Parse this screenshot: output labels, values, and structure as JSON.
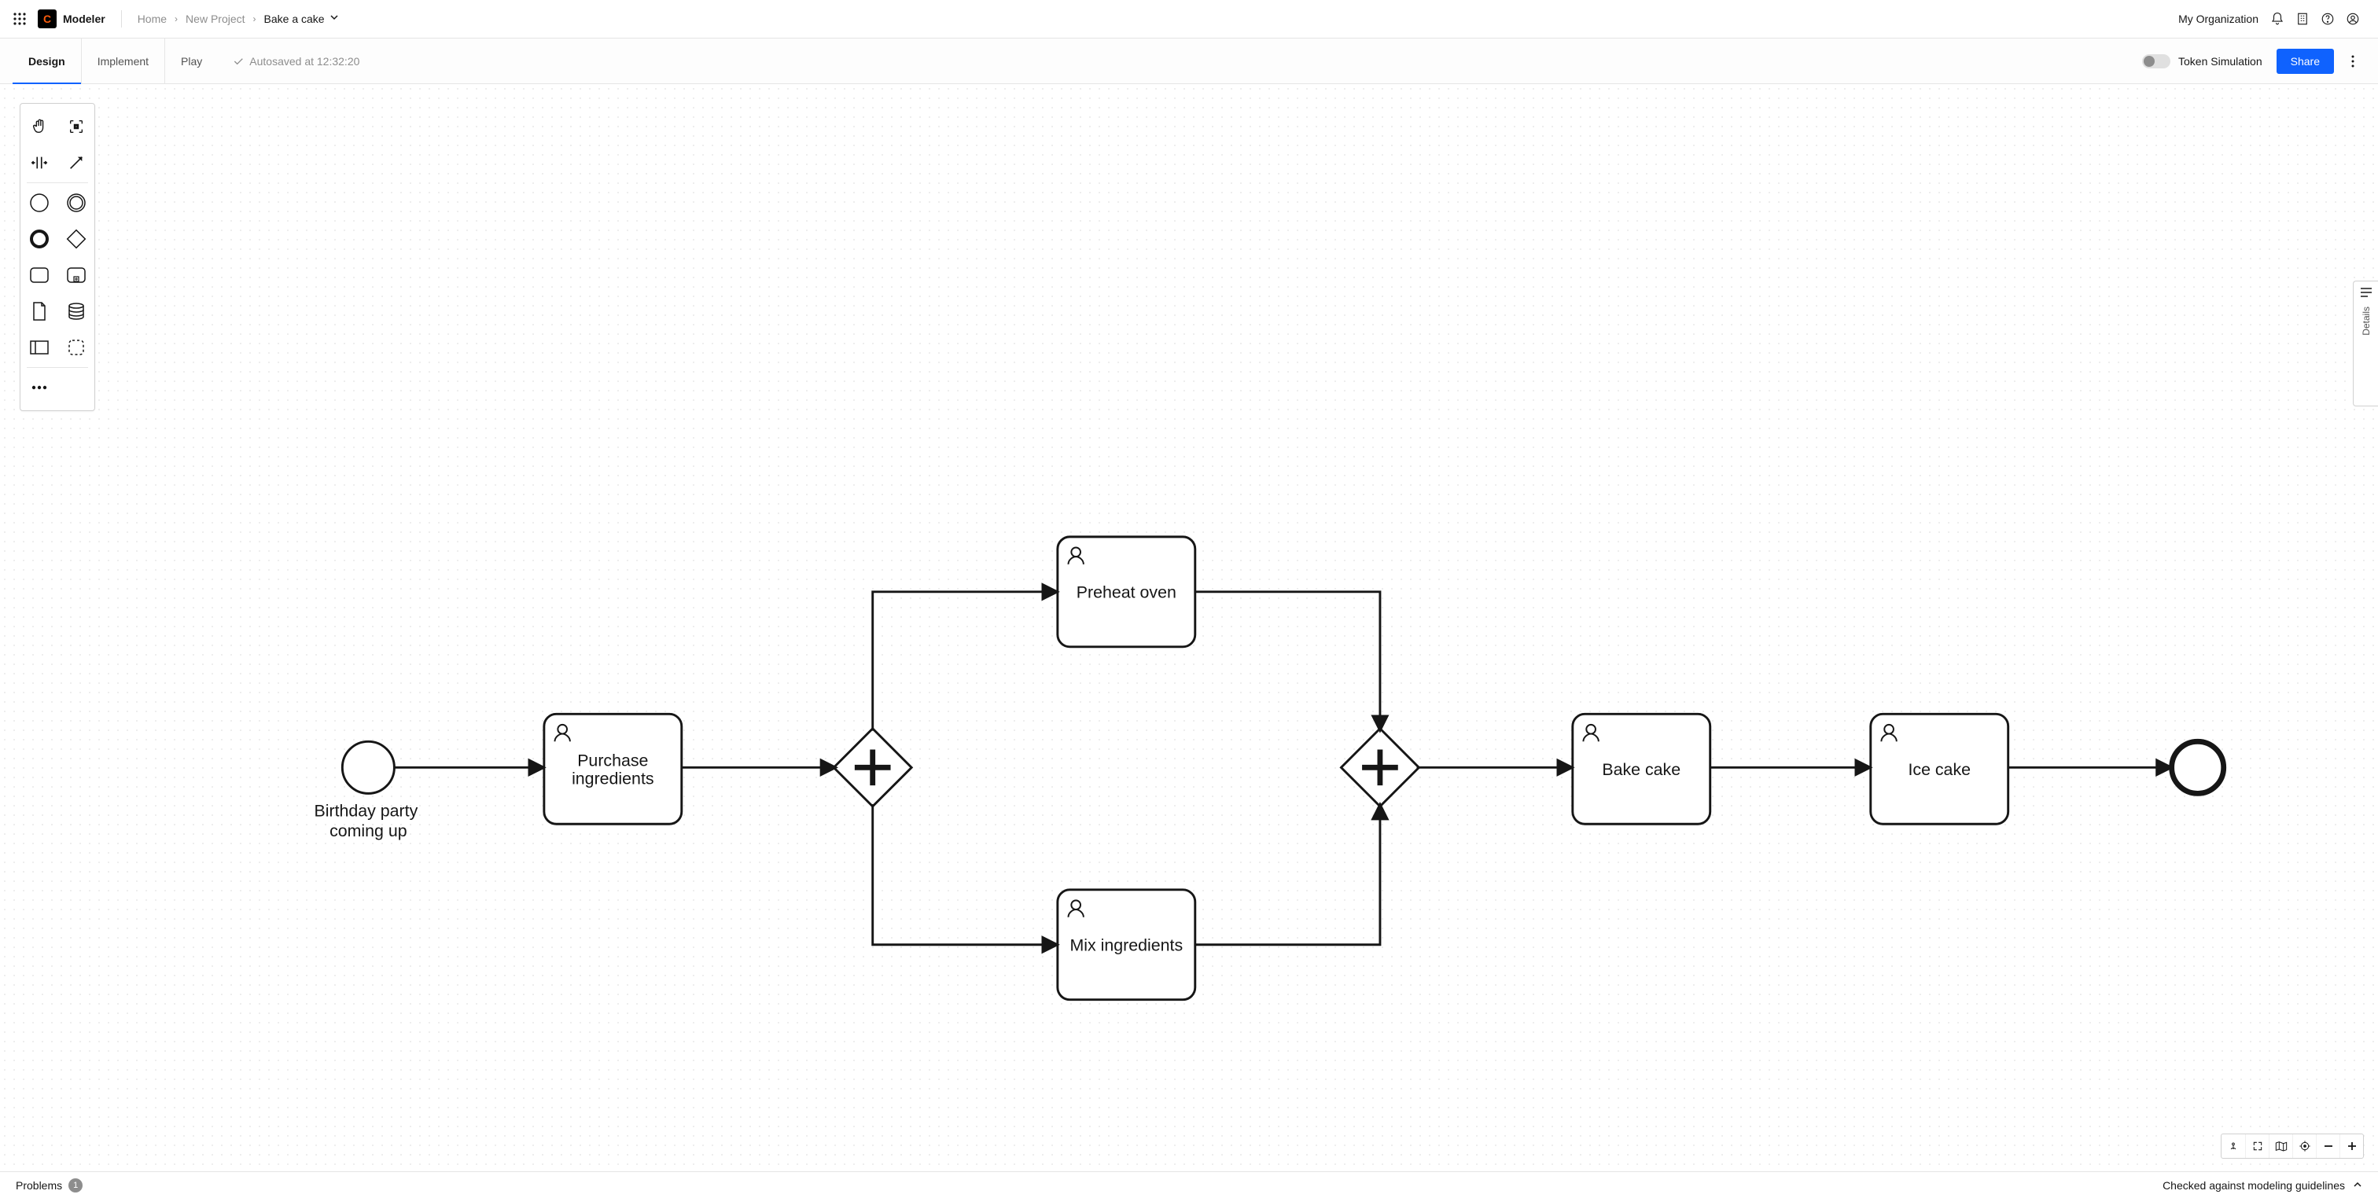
{
  "brand": {
    "name": "Modeler",
    "logo_letter": "C"
  },
  "breadcrumbs": {
    "home": "Home",
    "project": "New Project",
    "current": "Bake a cake"
  },
  "org": {
    "label": "My Organization"
  },
  "tabs": {
    "design": "Design",
    "implement": "Implement",
    "play": "Play"
  },
  "autosave": {
    "text": "Autosaved at 12:32:20"
  },
  "simulation": {
    "label": "Token Simulation"
  },
  "share": {
    "label": "Share"
  },
  "details_panel": {
    "label": "Details"
  },
  "statusbar": {
    "problems_label": "Problems",
    "problems_count": "1",
    "guideline_text": "Checked against modeling guidelines"
  },
  "diagram": {
    "start_event_label": "Birthday party coming up",
    "task_purchase": "Purchase ingredients",
    "task_preheat": "Preheat oven",
    "task_mix": "Mix ingredients",
    "task_bake": "Bake cake",
    "task_ice": "Ice cake"
  }
}
